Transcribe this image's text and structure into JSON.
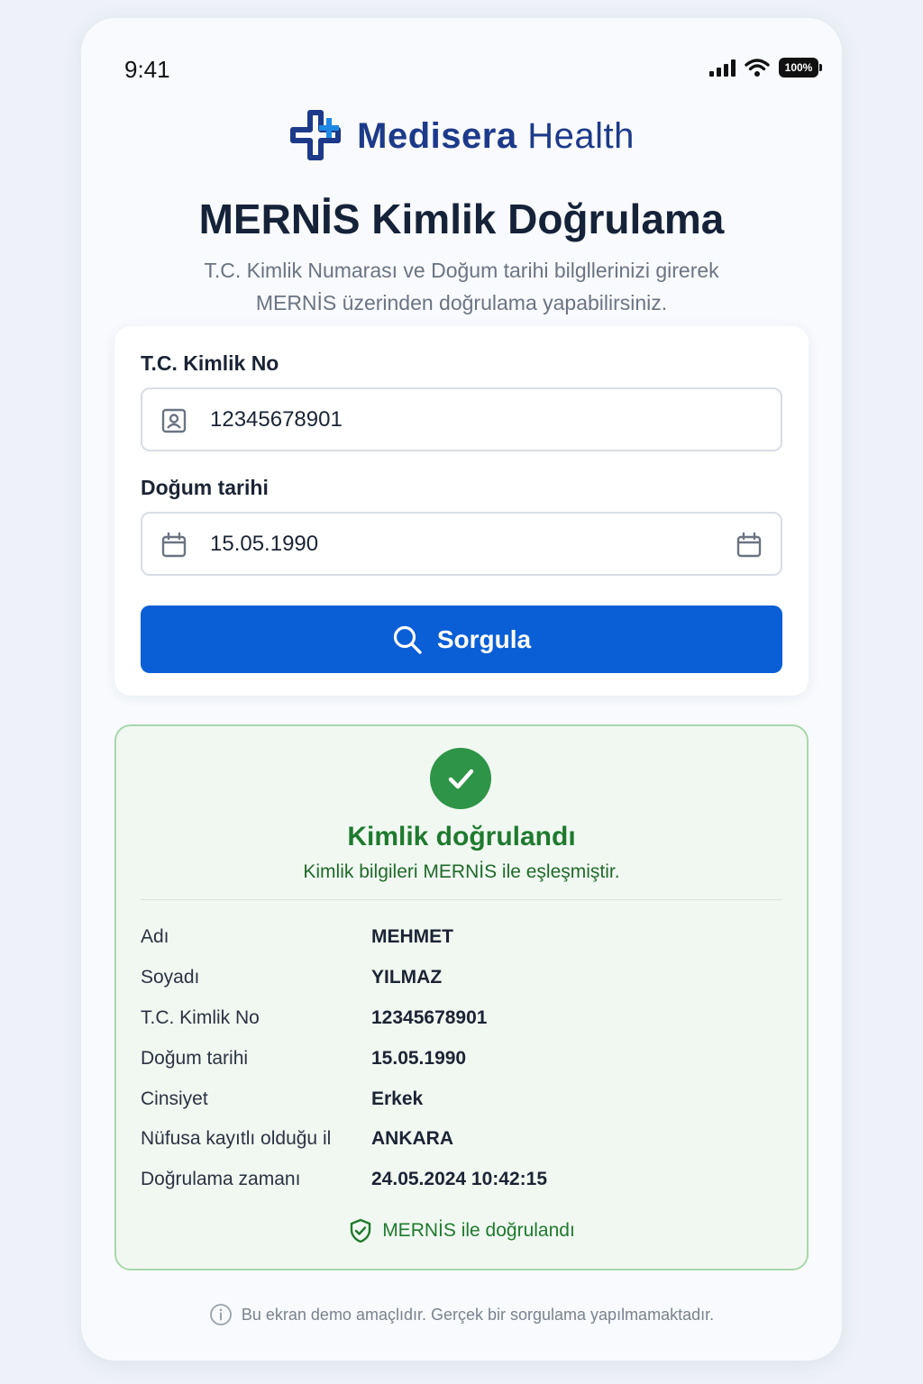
{
  "status_bar": {
    "time": "9:41",
    "battery": "100%"
  },
  "brand": {
    "name_bold": "Medisera",
    "name_light": "Health"
  },
  "header": {
    "title": "MERNİS Kimlik Doğrulama",
    "subtitle_line1": "T.C. Kimlik Numarası ve Doğum tarihi bilgllerinizi girerek",
    "subtitle_line2": "MERNİS üzerinden doğrulama yapabilirsiniz."
  },
  "form": {
    "tc_label": "T.C. Kimlik No",
    "tc_value": "12345678901",
    "dob_label": "Doğum tarihi",
    "dob_value": "15.05.1990",
    "submit_label": "Sorgula"
  },
  "result": {
    "title": "Kimlik doğrulandı",
    "subtitle": "Kimlik bilgileri MERNİS ile eşleşmiştir.",
    "rows": [
      {
        "key": "Adı",
        "value": "MEHMET"
      },
      {
        "key": "Soyadı",
        "value": "YILMAZ"
      },
      {
        "key": "T.C. Kimlik No",
        "value": "12345678901"
      },
      {
        "key": "Doğum tarihi",
        "value": "15.05.1990"
      },
      {
        "key": "Cinsiyet",
        "value": "Erkek"
      },
      {
        "key": "Nüfusa kayıtlı olduğu il",
        "value": "ANKARA"
      },
      {
        "key": "Doğrulama zamanı",
        "value": "24.05.2024 10:42:15"
      }
    ],
    "badge": "MERNİS ile doğrulandı"
  },
  "footer": {
    "note": "Bu ekran demo amaçlıdır. Gerçek bir sorgulama yapılmamaktadır."
  },
  "colors": {
    "brand": "#1d3a8a",
    "primary_button": "#0a5fd6",
    "success": "#2e9447",
    "success_text": "#1f7a2f",
    "success_bg": "#f1f8f1"
  },
  "icons": [
    "signal-icon",
    "wifi-icon",
    "battery-icon",
    "medical-cross-logo-icon",
    "id-card-icon",
    "calendar-icon",
    "search-icon",
    "check-icon",
    "shield-check-icon",
    "info-icon"
  ]
}
